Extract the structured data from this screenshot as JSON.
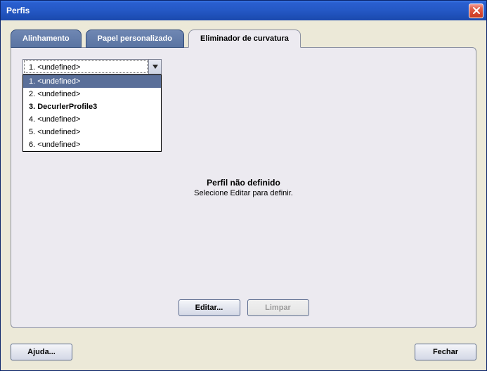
{
  "window": {
    "title": "Perfis"
  },
  "tabs": {
    "items": [
      {
        "label": "Alinhamento"
      },
      {
        "label": "Papel personalizado"
      },
      {
        "label": "Eliminador de curvatura"
      }
    ]
  },
  "combo": {
    "selected": "1. <undefined>"
  },
  "dropdown": {
    "items": [
      {
        "label": "1. <undefined>"
      },
      {
        "label": "2. <undefined>"
      },
      {
        "label": "3. DecurlerProfile3"
      },
      {
        "label": "4. <undefined>"
      },
      {
        "label": "5. <undefined>"
      },
      {
        "label": "6. <undefined>"
      }
    ]
  },
  "center": {
    "line1": "Perfil não definido",
    "line2": "Selecione Editar para definir."
  },
  "buttons": {
    "edit": "Editar...",
    "clear": "Limpar",
    "help": "Ajuda...",
    "close": "Fechar"
  }
}
